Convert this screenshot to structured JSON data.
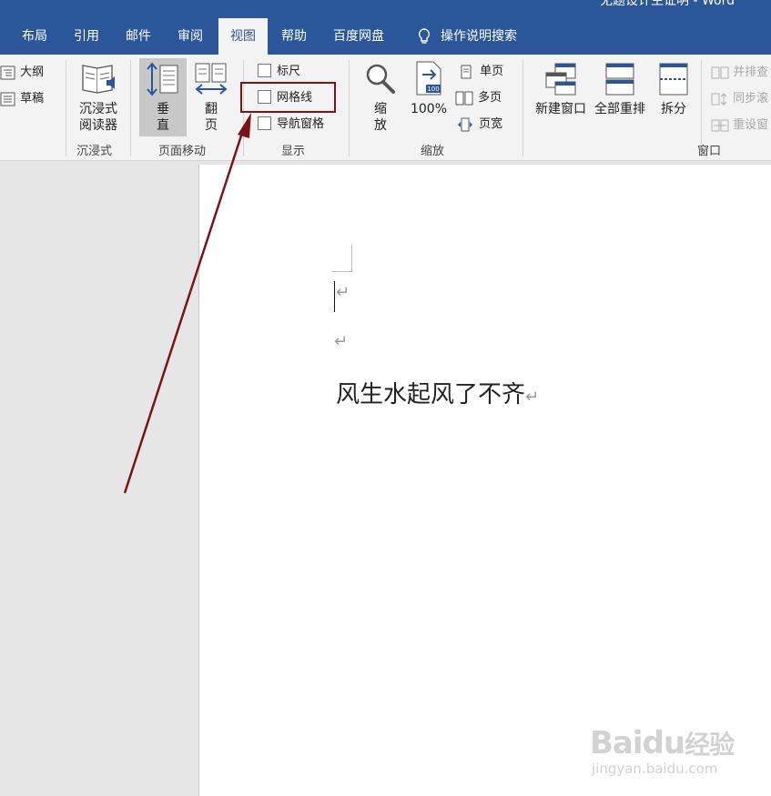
{
  "window": {
    "title": "无题设计生证明 - Word"
  },
  "tabs": [
    {
      "label": "布局"
    },
    {
      "label": "引用"
    },
    {
      "label": "邮件"
    },
    {
      "label": "审阅"
    },
    {
      "label": "视图",
      "active": true
    },
    {
      "label": "帮助"
    },
    {
      "label": "百度网盘"
    }
  ],
  "tell_me": {
    "label": "操作说明搜索",
    "icon": "lightbulb-icon"
  },
  "ribbon": {
    "views": {
      "outline": "大纲",
      "draft": "草稿"
    },
    "immersive": {
      "reader_line1": "沉浸式",
      "reader_line2": "阅读器",
      "group": "沉浸式"
    },
    "page_movement": {
      "vertical_line1": "垂",
      "vertical_line2": "直",
      "flip_line1": "翻",
      "flip_line2": "页",
      "group": "页面移动"
    },
    "show": {
      "ruler": "标尺",
      "gridlines": "网格线",
      "nav_pane": "导航窗格",
      "group": "显示"
    },
    "zoom": {
      "zoom_line1": "缩",
      "zoom_line2": "放",
      "hundred": "100%",
      "one_page": "单页",
      "multi_page": "多页",
      "page_width": "页宽",
      "group": "缩放"
    },
    "window": {
      "new_window": "新建窗口",
      "arrange_all": "全部重排",
      "split": "拆分",
      "side_by_side": "并排查",
      "sync_scroll": "同步滚",
      "reset_pos": "重设窗",
      "group": "窗口"
    }
  },
  "document": {
    "pilcrow": "↵",
    "line3": "风生水起风了不齐"
  },
  "watermark": {
    "brand": "Baidu",
    "jingyan": "经验",
    "url": "jingyan.baidu.com"
  },
  "colors": {
    "accent": "#2b579a",
    "highlight": "#7b1416",
    "ribbon_bg": "#f3f3f3"
  }
}
